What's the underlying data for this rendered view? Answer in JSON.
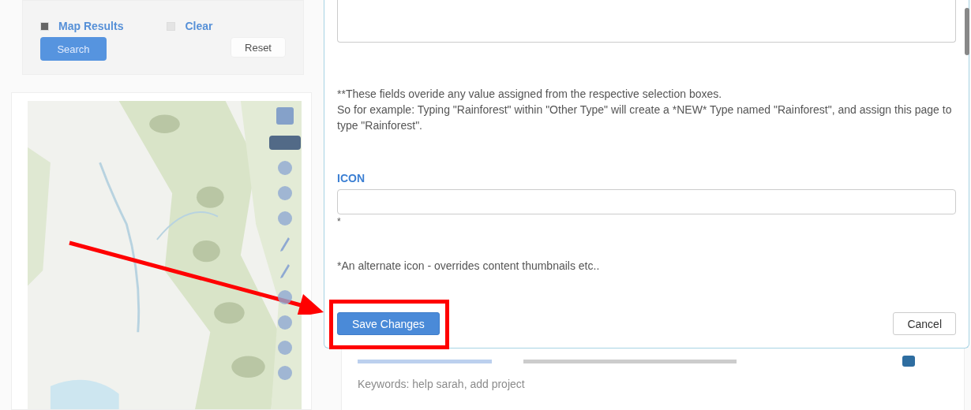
{
  "search_panel": {
    "options": [
      {
        "label": "Map Results",
        "checked": true
      },
      {
        "label": "Clear",
        "checked": false
      }
    ],
    "search_button": "Search",
    "reset_button": "Reset"
  },
  "modal": {
    "notes": [
      "**These fields overide any value assigned from the respective selection boxes.",
      "So for example: Typing \"Rainforest\" within \"Other Type\" will create a *NEW* Type named \"Rainforest\", and assign this page to type \"Rainforest\"."
    ],
    "icon_field": {
      "label": "ICON",
      "mark": "*",
      "note": "*An alternate icon - overrides content thumbnails etc.."
    },
    "save_button": "Save Changes",
    "cancel_button": "Cancel"
  },
  "background_card": {
    "keywords": "Keywords: help sarah, add project"
  }
}
